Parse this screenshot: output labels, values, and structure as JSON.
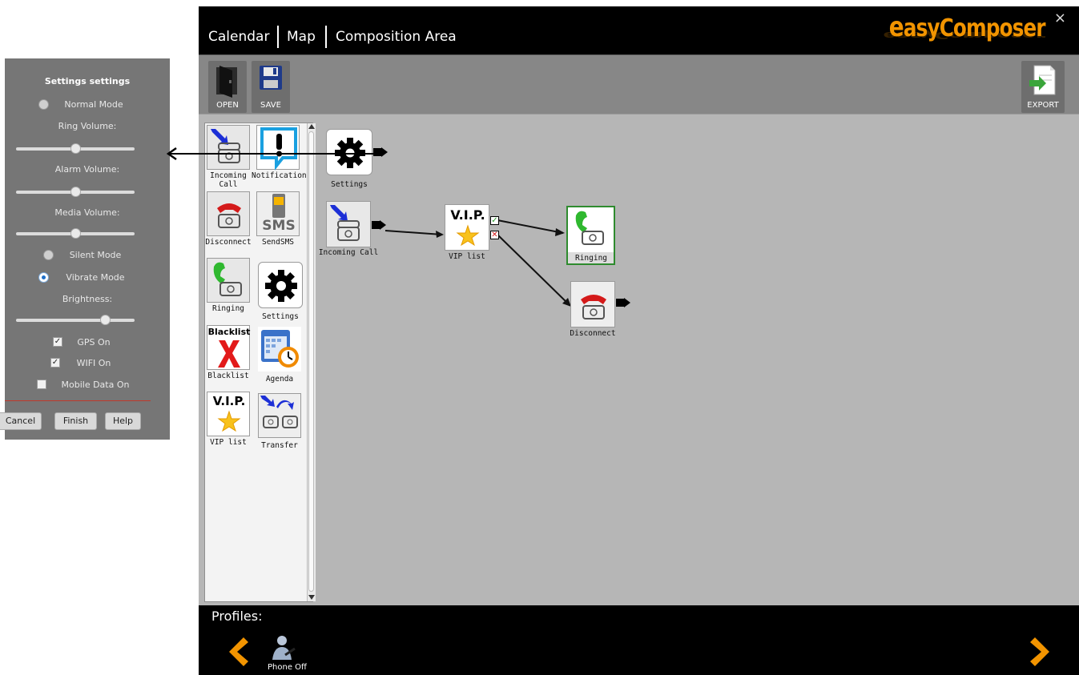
{
  "nav": {
    "calendar": "Calendar",
    "map": "Map",
    "composition": "Composition Area"
  },
  "brand": {
    "logo_e": "e",
    "logo_rest": "asyComposer",
    "close": "×"
  },
  "toolbar": {
    "open": "OPEN",
    "save": "SAVE",
    "export": "EXPORT"
  },
  "palette": {
    "incoming_call": "Incoming Call",
    "notification": "Notification",
    "disconnect": "Disconnect",
    "sendsms": "SendSMS",
    "ringing": "Ringing",
    "settings": "Settings",
    "blacklist": "Blacklist",
    "blacklist_tile": "Blacklist",
    "agenda": "Agenda",
    "vip": "VIP list",
    "vip_tile": "V.I.P.",
    "transfer": "Transfer",
    "sms_tile": "SMS"
  },
  "canvas": {
    "settings": "Settings",
    "incoming_call": "Incoming Call",
    "vip": "VIP list",
    "vip_tile": "V.I.P.",
    "ringing": "Ringing",
    "disconnect": "Disconnect"
  },
  "profiles": {
    "label": "Profiles:",
    "item": "Phone Off"
  },
  "dialog": {
    "title": "Settings settings",
    "normal_mode": "Normal Mode",
    "ring_volume": "Ring Volume:",
    "ring_level": 0.5,
    "alarm_volume": "Alarm Volume:",
    "alarm_level": 0.5,
    "media_volume": "Media Volume:",
    "media_level": 0.5,
    "silent_mode": "Silent Mode",
    "vibrate_mode": "Vibrate Mode",
    "brightness": "Brightness:",
    "brightness_level": 0.75,
    "gps": "GPS On",
    "gps_checked": true,
    "wifi": "WIFI On",
    "wifi_checked": true,
    "mobile_data": "Mobile Data On",
    "mobile_data_checked": false,
    "cancel": "Cancel",
    "finish": "Finish",
    "help": "Help"
  },
  "colors": {
    "brand": "#f29400",
    "accent_blue": "#1d6fc9",
    "ringing_border": "#2e8b2e"
  }
}
